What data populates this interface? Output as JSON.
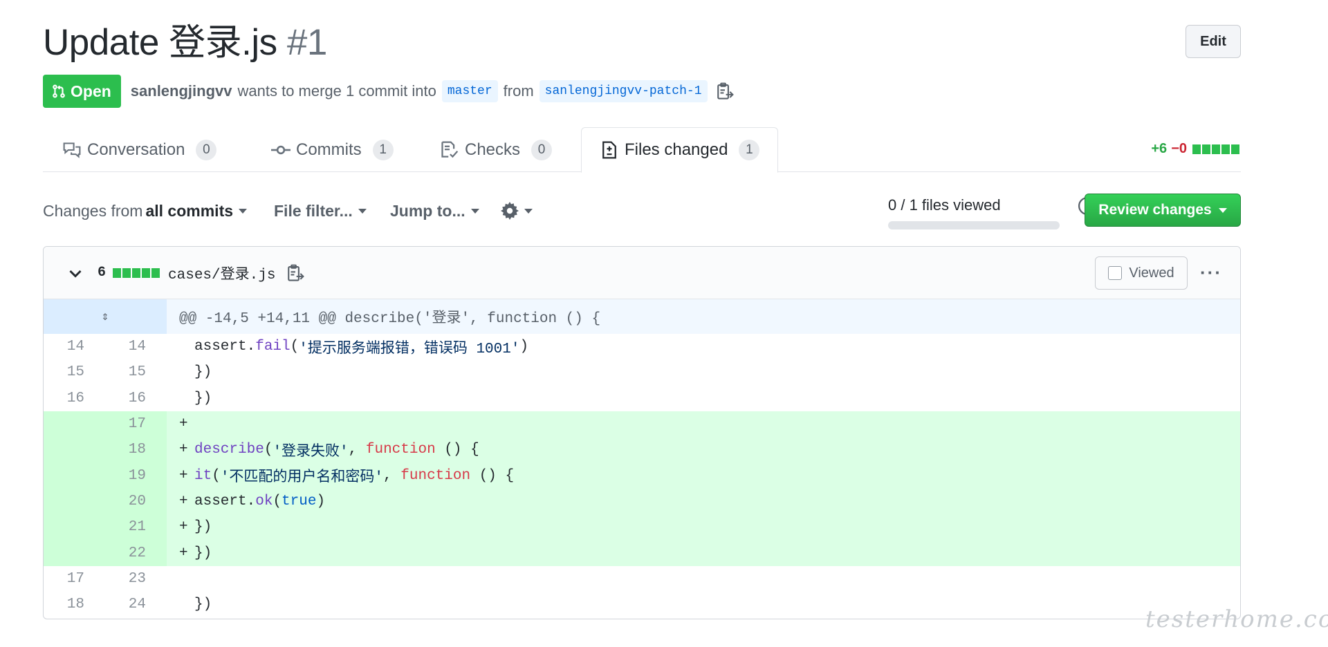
{
  "header": {
    "title": "Update 登录.js",
    "number": "#1",
    "edit_label": "Edit"
  },
  "meta": {
    "state": "Open",
    "author": "sanlengjingvv",
    "action_text": "wants to merge 1 commit into",
    "base_branch": "master",
    "from_text": "from",
    "head_branch": "sanlengjingvv-patch-1"
  },
  "tabs": [
    {
      "label": "Conversation",
      "count": "0",
      "icon": "comment-discussion-icon"
    },
    {
      "label": "Commits",
      "count": "1",
      "icon": "git-commit-icon"
    },
    {
      "label": "Checks",
      "count": "0",
      "icon": "checklist-icon"
    },
    {
      "label": "Files changed",
      "count": "1",
      "icon": "diff-icon",
      "selected": true
    }
  ],
  "diffstat": {
    "additions": "+6",
    "deletions": "−0"
  },
  "toolbar": {
    "changes_from_prefix": "Changes from",
    "changes_from_value": "all commits",
    "file_filter": "File filter...",
    "jump_to": "Jump to...",
    "files_viewed": "0 / 1 files viewed",
    "viewed_fraction": 0,
    "review_label": "Review changes"
  },
  "file": {
    "change_count": "6",
    "path": "cases/登录.js",
    "viewed_label": "Viewed",
    "more_label": "···"
  },
  "hunk_header": "@@ -14,5 +14,11 @@ describe('登录', function () {",
  "expand_label": "⇕",
  "watermark": "testerhome.com",
  "colors": {
    "added_bg": "#e6ffed",
    "added_num_bg": "#cdffd8",
    "green": "#2cbe4e",
    "red": "#cb2431"
  }
}
